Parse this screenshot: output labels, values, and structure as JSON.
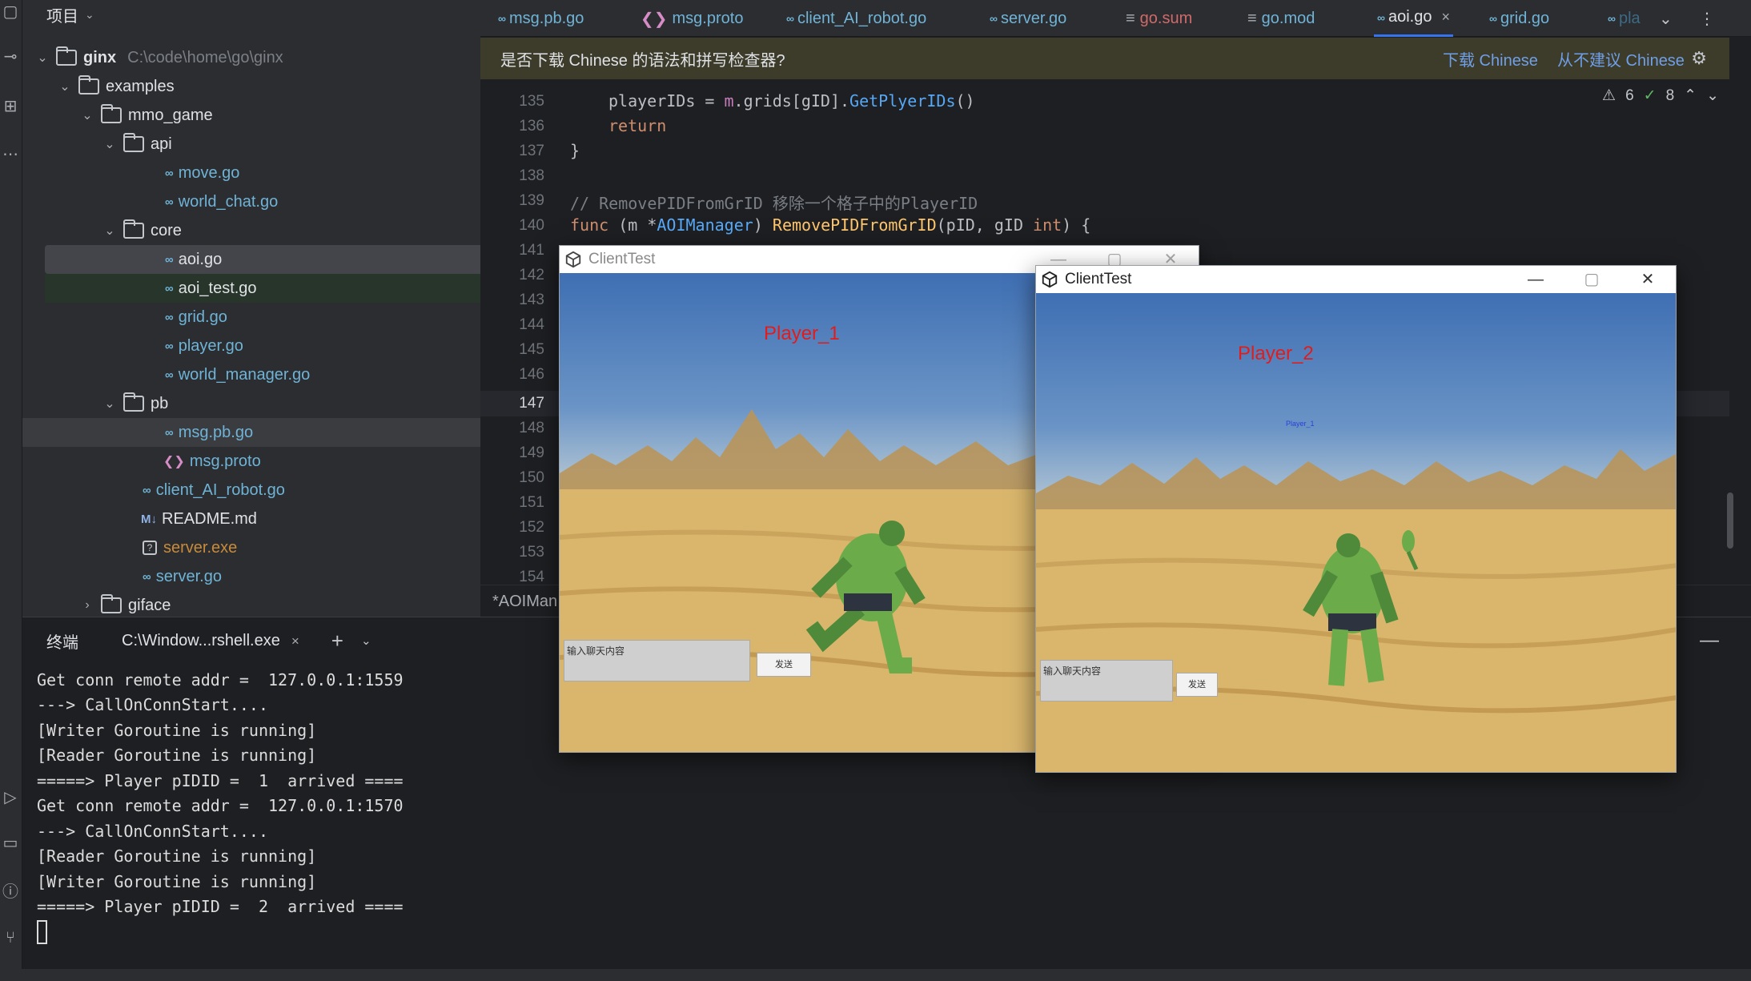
{
  "project": {
    "title": "项目",
    "root_name": "ginx",
    "root_path": "C:\\code\\home\\go\\ginx",
    "items": [
      {
        "label": "examples"
      },
      {
        "label": "mmo_game"
      },
      {
        "label": "api"
      },
      {
        "label": "move.go"
      },
      {
        "label": "world_chat.go"
      },
      {
        "label": "core"
      },
      {
        "label": "aoi.go"
      },
      {
        "label": "aoi_test.go"
      },
      {
        "label": "grid.go"
      },
      {
        "label": "player.go"
      },
      {
        "label": "world_manager.go"
      },
      {
        "label": "pb"
      },
      {
        "label": "msg.pb.go"
      },
      {
        "label": "msg.proto"
      },
      {
        "label": "client_AI_robot.go"
      },
      {
        "label": "README.md"
      },
      {
        "label": "server.exe"
      },
      {
        "label": "server.go"
      },
      {
        "label": "giface"
      }
    ]
  },
  "tabs": [
    {
      "label": "msg.pb.go",
      "icon": "go-file-icon"
    },
    {
      "label": "msg.proto",
      "icon": "proto-file-icon"
    },
    {
      "label": "client_AI_robot.go",
      "icon": "go-file-icon"
    },
    {
      "label": "server.go",
      "icon": "go-file-icon"
    },
    {
      "label": "go.sum",
      "icon": "mod-file-icon"
    },
    {
      "label": "go.mod",
      "icon": "mod-file-icon"
    },
    {
      "label": "aoi.go",
      "icon": "go-file-icon",
      "active": true
    },
    {
      "label": "grid.go",
      "icon": "go-file-icon"
    },
    {
      "label": "pla",
      "icon": "go-file-icon"
    }
  ],
  "notice": {
    "message": "是否下载 Chinese 的语法和拼写检查器?",
    "download": "下载 Chinese",
    "never": "从不建议 Chinese"
  },
  "inspections": {
    "warnings": "6",
    "ok": "8"
  },
  "editor": {
    "line_numbers": [
      "135",
      "136",
      "137",
      "138",
      "139",
      "140",
      "141",
      "142",
      "143",
      "144",
      "145",
      "146",
      "147",
      "148",
      "149",
      "150",
      "151",
      "152",
      "153",
      "154"
    ],
    "current_line": "147",
    "code": {
      "l135_a": "playerIDs = ",
      "l135_b": "m",
      "l135_c": ".grids[gID].",
      "l135_d": "GetPlyerIDs",
      "l135_e": "()",
      "l136": "return",
      "l137": "}",
      "l139_comment": "// RemovePIDFromGrID 移除一个格子中的PlayerID",
      "l140_func": "func",
      "l140_recv": " (m *",
      "l140_type": "AOIManager",
      "l140_close": ") ",
      "l140_name": "RemovePIDFromGrID",
      "l140_params": "(pID, gID ",
      "l140_int": "int",
      "l140_end": ") {"
    },
    "breadcrumb": "*AOIMan"
  },
  "terminal": {
    "title": "终端",
    "tab_label": "C:\\Window...rshell.exe",
    "lines": [
      "Get conn remote addr =  127.0.0.1:1559",
      "---> CallOnConnStart....",
      "[Writer Goroutine is running]",
      "[Reader Goroutine is running]",
      "=====> Player pIDID =  1  arrived ====",
      "Get conn remote addr =  127.0.0.1:1570",
      "---> CallOnConnStart....",
      "[Reader Goroutine is running]",
      "[Writer Goroutine is running]",
      "=====> Player pIDID =  2  arrived ===="
    ]
  },
  "client1": {
    "title": "ClientTest",
    "player_name": "Player_1",
    "chat_placeholder": "输入聊天内容",
    "send_label": "发送"
  },
  "client2": {
    "title": "ClientTest",
    "player_name": "Player_2",
    "remote_player_label": "Player_1",
    "chat_placeholder": "输入聊天内容",
    "send_label": "发送"
  },
  "colors": {
    "accent": "#3574f0",
    "player_label": "#e11c1c",
    "notice_bg": "#3d3b2a"
  }
}
